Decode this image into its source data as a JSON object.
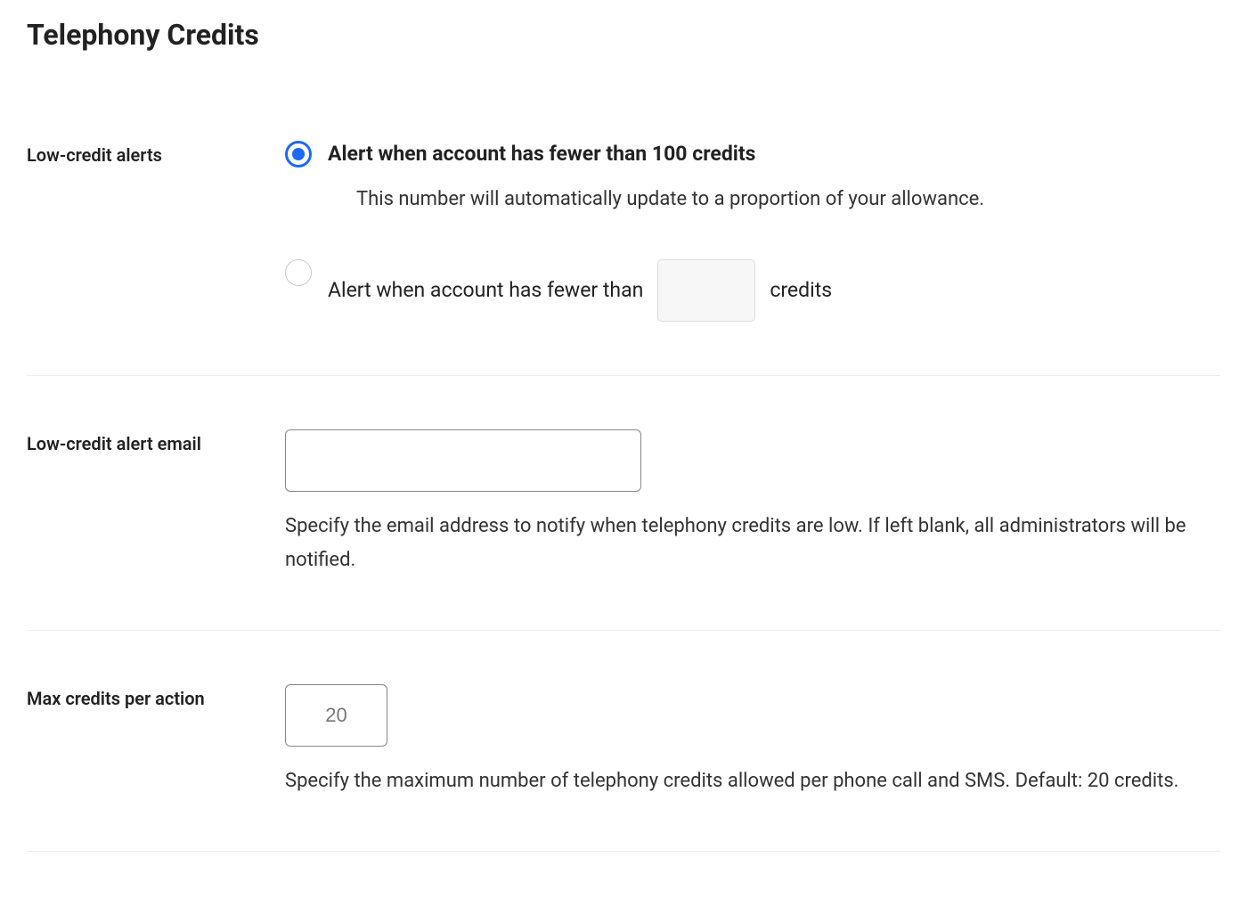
{
  "page": {
    "title": "Telephony Credits"
  },
  "lowCreditAlerts": {
    "label": "Low-credit alerts",
    "option1": {
      "label": "Alert when account has fewer than 100 credits",
      "help": "This number will automatically update to a proportion of your allowance."
    },
    "option2": {
      "labelPrefix": "Alert when account has fewer than",
      "labelSuffix": "credits",
      "inputValue": ""
    }
  },
  "alertEmail": {
    "label": "Low-credit alert email",
    "value": "",
    "help": "Specify the email address to notify when telephony credits are low. If left blank, all administrators will be notified."
  },
  "maxCredits": {
    "label": "Max credits per action",
    "value": "20",
    "help": "Specify the maximum number of telephony credits allowed per phone call and SMS. Default: 20 credits."
  }
}
